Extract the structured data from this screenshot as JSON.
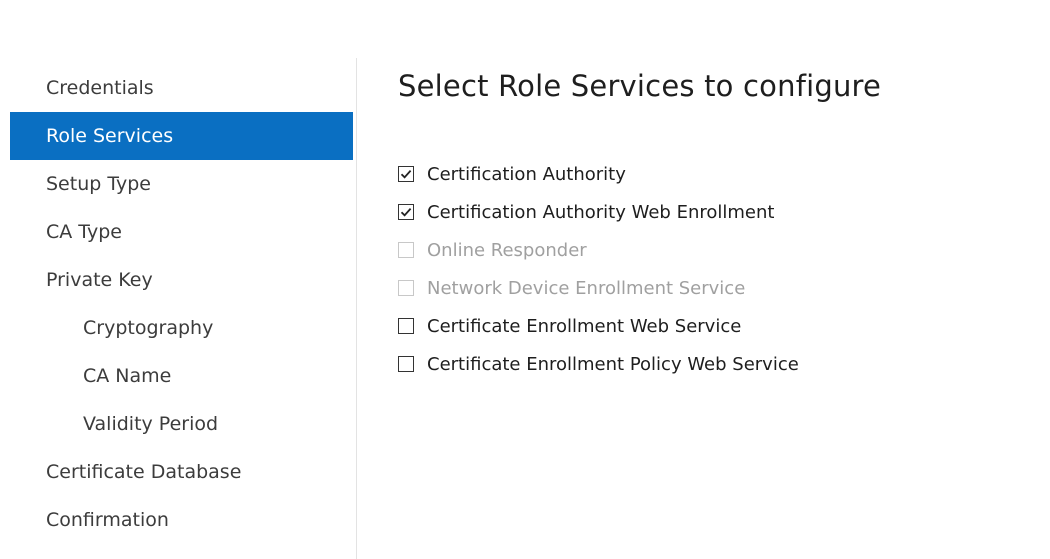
{
  "nav": {
    "items": [
      {
        "label": "Credentials"
      },
      {
        "label": "Role Services"
      },
      {
        "label": "Setup Type"
      },
      {
        "label": "CA Type"
      },
      {
        "label": "Private Key"
      },
      {
        "label": "Cryptography"
      },
      {
        "label": "CA Name"
      },
      {
        "label": "Validity Period"
      },
      {
        "label": "Certificate Database"
      },
      {
        "label": "Confirmation"
      }
    ],
    "active_index": 1,
    "accent_color": "#0a6fc2"
  },
  "main": {
    "title": "Select Role Services to configure",
    "services": [
      {
        "label": "Certification Authority",
        "checked": true,
        "enabled": true
      },
      {
        "label": "Certification Authority Web Enrollment",
        "checked": true,
        "enabled": true
      },
      {
        "label": "Online Responder",
        "checked": false,
        "enabled": false
      },
      {
        "label": "Network Device Enrollment Service",
        "checked": false,
        "enabled": false
      },
      {
        "label": "Certificate Enrollment Web Service",
        "checked": false,
        "enabled": true
      },
      {
        "label": "Certificate Enrollment Policy Web Service",
        "checked": false,
        "enabled": true
      }
    ]
  }
}
